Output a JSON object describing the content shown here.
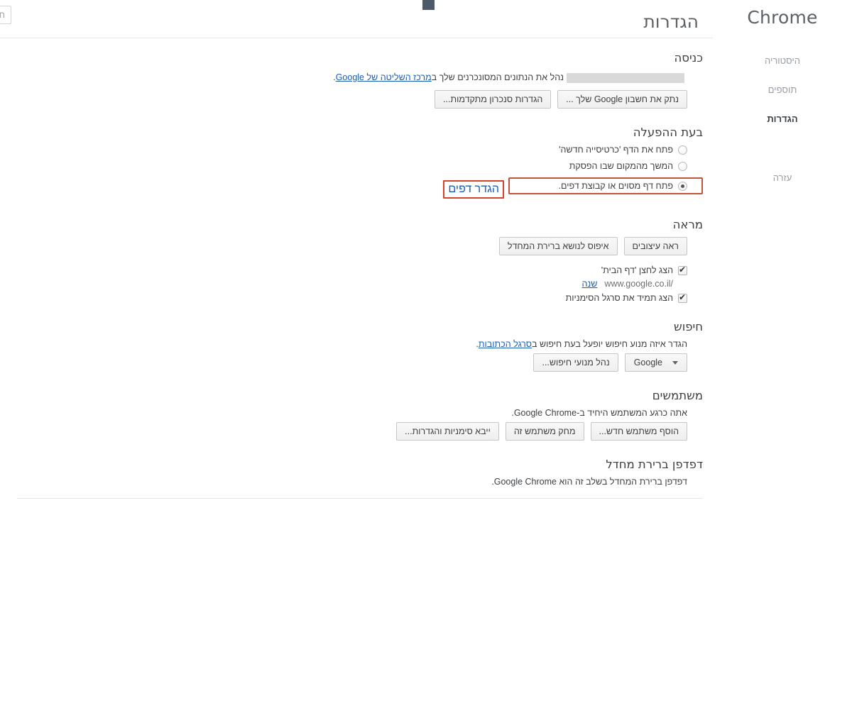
{
  "brand": "Chrome",
  "sidebar": {
    "items": [
      {
        "label": "היסטוריה",
        "active": false
      },
      {
        "label": "תוספים",
        "active": false
      },
      {
        "label": "הגדרות",
        "active": true
      },
      {
        "label": "עזרה",
        "active": false
      }
    ]
  },
  "header": {
    "title": "הגדרות"
  },
  "search": {
    "placeholder": "חפש בהגדרות",
    "value": ""
  },
  "signin": {
    "title": "כניסה",
    "manage_text_before": "נהל את הנתונים המסונכרנים שלך ב",
    "manage_link": "מרכז השליטה של Google",
    "manage_text_after": ".",
    "account_masked": "",
    "disconnect_button": "נתק את חשבון Google שלך ...",
    "advanced_sync_button": "הגדרות סנכרון מתקדמות..."
  },
  "startup": {
    "title": "בעת ההפעלה",
    "options": [
      {
        "label": "פתח את הדף 'כרטיסייה חדשה'",
        "checked": false
      },
      {
        "label": "המשך מהמקום שבו הפסקת",
        "checked": false
      },
      {
        "label": "פתח דף מסוים או קבוצת דפים.",
        "checked": true
      }
    ],
    "set_pages_link": "הגדר דפים"
  },
  "appearance": {
    "title": "מראה",
    "get_themes_button": "ראה עיצובים",
    "reset_theme_button": "איפוס לנושא ברירת המחדל",
    "show_home_button": {
      "label": "הצג לחצן 'דף הבית'",
      "checked": true
    },
    "homepage_url": "www.google.co.il/",
    "change_link": "שנה",
    "always_show_bookmarks": {
      "label": "הצג תמיד את סרגל הסימניות",
      "checked": true
    }
  },
  "search_section": {
    "title": "חיפוש",
    "desc_before": "הגדר איזה מנוע חיפוש יופעל בעת חיפוש ב",
    "desc_link": "סרגל הכתובות",
    "desc_after": ".",
    "engine_selected": "Google",
    "manage_engines_button": "נהל מנועי חיפוש..."
  },
  "users": {
    "title": "משתמשים",
    "desc": "אתה כרגע המשתמש היחיד ב-Google Chrome.",
    "add_user_button": "הוסף משתמש חדש...",
    "delete_user_button": "מחק משתמש זה",
    "import_button": "ייבא סימניות והגדרות..."
  },
  "default_browser": {
    "title": "דפדפן ברירת מחדל",
    "desc": "דפדפן ברירת המחדל בשלב זה הוא Google Chrome."
  },
  "colors": {
    "highlight": "#c0543a",
    "highlight_strong": "#d4432b",
    "link": "#1a5fb4",
    "artifact": "#4c5b6b"
  }
}
